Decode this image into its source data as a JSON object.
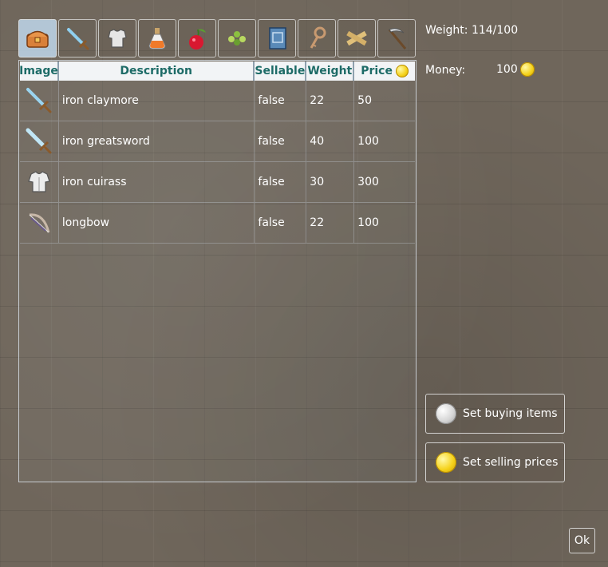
{
  "tabs": [
    {
      "name": "chest-icon",
      "active": true
    },
    {
      "name": "sword-icon",
      "active": false
    },
    {
      "name": "armor-icon",
      "active": false
    },
    {
      "name": "potion-icon",
      "active": false
    },
    {
      "name": "cherry-icon",
      "active": false
    },
    {
      "name": "herb-icon",
      "active": false
    },
    {
      "name": "book-icon",
      "active": false
    },
    {
      "name": "key-icon",
      "active": false
    },
    {
      "name": "planks-icon",
      "active": false
    },
    {
      "name": "scythe-icon",
      "active": false
    }
  ],
  "table": {
    "headers": {
      "image": "Image",
      "description": "Description",
      "sellable": "Sellable",
      "weight": "Weight",
      "price": "Price"
    },
    "rows": [
      {
        "icon": "sword-icon",
        "description": "iron claymore",
        "sellable": "false",
        "weight": "22",
        "price": "50"
      },
      {
        "icon": "sword-icon",
        "description": "iron greatsword",
        "sellable": "false",
        "weight": "40",
        "price": "100"
      },
      {
        "icon": "cuirass-icon",
        "description": "iron cuirass",
        "sellable": "false",
        "weight": "30",
        "price": "300"
      },
      {
        "icon": "bow-icon",
        "description": "longbow",
        "sellable": "false",
        "weight": "22",
        "price": "100"
      }
    ]
  },
  "status": {
    "weight_text": "Weight: 114/100",
    "money_label": "Money:",
    "money_value": "100"
  },
  "buttons": {
    "set_buying": "Set buying items",
    "set_selling": "Set selling prices",
    "ok": "Ok"
  },
  "colors": {
    "header_text": "#1d6b67",
    "active_tab": "#bed7eb",
    "coin_gold": "#f5d21a"
  }
}
